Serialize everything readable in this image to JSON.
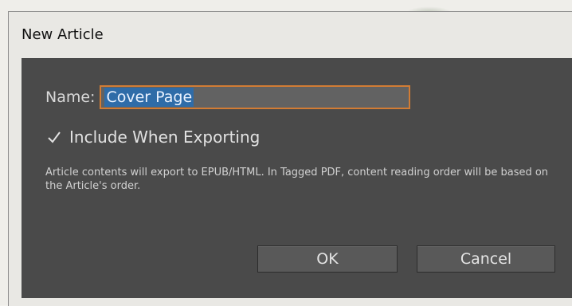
{
  "window": {
    "title": "New Article"
  },
  "form": {
    "name_label": "Name:",
    "name_value": "Cover Page",
    "include_label": "Include When Exporting",
    "include_checked": true,
    "info_text": "Article contents will export to EPUB/HTML. In Tagged PDF, content reading order will be based on the Article's order."
  },
  "buttons": {
    "ok_label": "OK",
    "cancel_label": "Cancel"
  },
  "colors": {
    "dialog_bg": "#4a4a4a",
    "input_focus_border": "#d27c34",
    "selection": "#2f6ca8"
  },
  "icons": {
    "checkbox": "checkmark-icon"
  }
}
